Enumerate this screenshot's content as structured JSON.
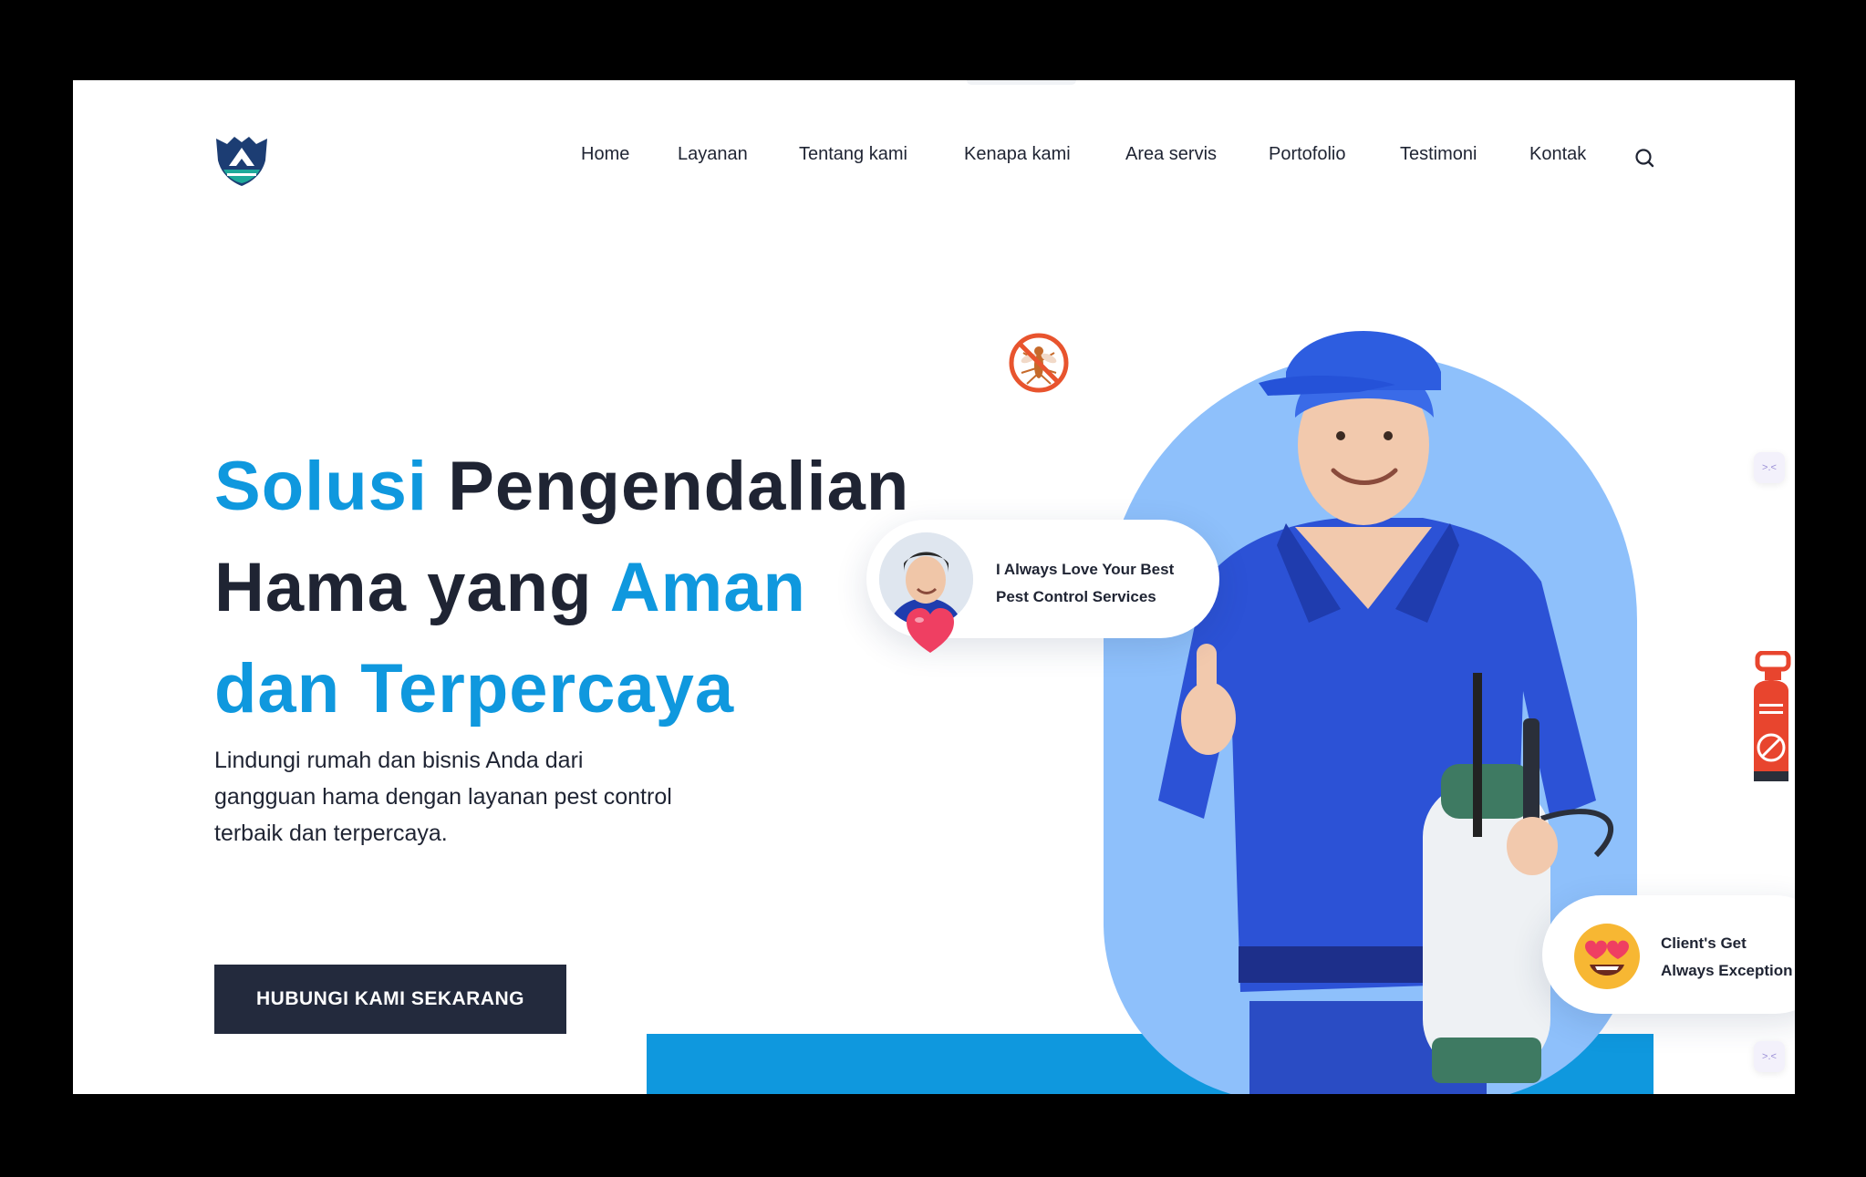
{
  "nav": {
    "items": [
      {
        "label": "Home"
      },
      {
        "label": "Layanan"
      },
      {
        "label": "Tentang kami"
      },
      {
        "label": "Kenapa kami"
      },
      {
        "label": "Area servis"
      },
      {
        "label": "Portofolio"
      },
      {
        "label": "Testimoni"
      },
      {
        "label": "Kontak"
      }
    ],
    "search_icon": "search-icon"
  },
  "logo_icon": "shield-logo-icon",
  "hero": {
    "headline": {
      "line1_accent": "Solusi",
      "line1_rest": " Pengendalian",
      "line2_start": "Hama yang ",
      "line2_accent": "Aman",
      "line3_accent": "dan Terpercaya"
    },
    "subtext": "Lindungi rumah dan bisnis Anda dari gangguan hama dengan layanan pest control terbaik dan terpercaya.",
    "cta_label": "HUBUNGI KAMI SEKARANG"
  },
  "testimonial_card": {
    "line1": "I Always Love Your Best",
    "line2": "Pest Control Services"
  },
  "client_card": {
    "line1": "Client's Get",
    "line2": "Always Exception"
  },
  "widgets": {
    "glyph": ">.<"
  },
  "colors": {
    "accent": "#0f98de",
    "dark": "#232a3d",
    "shape_blue": "#8ec0fb",
    "text": "#1f2433"
  }
}
